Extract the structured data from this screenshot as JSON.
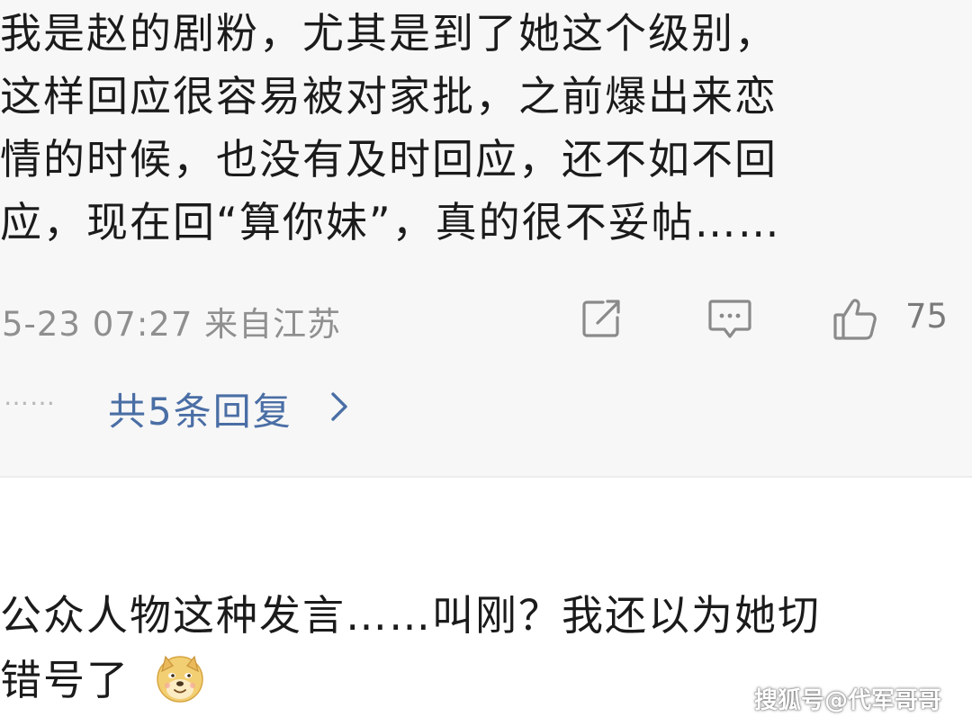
{
  "comment1": {
    "text_lines": [
      "我是赵的剧粉，尤其是到了她这个级别，",
      "这样回应很容易被对家批，之前爆出来恋",
      "情的时候，也没有及时回应，还不如不回",
      "应，现在回“算你妹”，真的很不妥帖……"
    ],
    "timestamp": "5-23 07:27",
    "location": "来自江苏",
    "like_count": "75",
    "icons": {
      "share": "share-icon",
      "reply": "comment-bubble-icon",
      "like": "thumbs-up-icon"
    },
    "replies_dots": "……",
    "replies_link": "共5条回复"
  },
  "comment2": {
    "line1": "公众人物这种发言……叫刚？我还以为她切",
    "line2": "错号了",
    "emoji": "doge-emoji-icon"
  },
  "watermark": "搜狐号@代军哥哥",
  "colors": {
    "card_background": "#f7f7f7",
    "link": "#4a6ea5",
    "text": "#1b1b1b",
    "meta": "#8f8f8f"
  }
}
